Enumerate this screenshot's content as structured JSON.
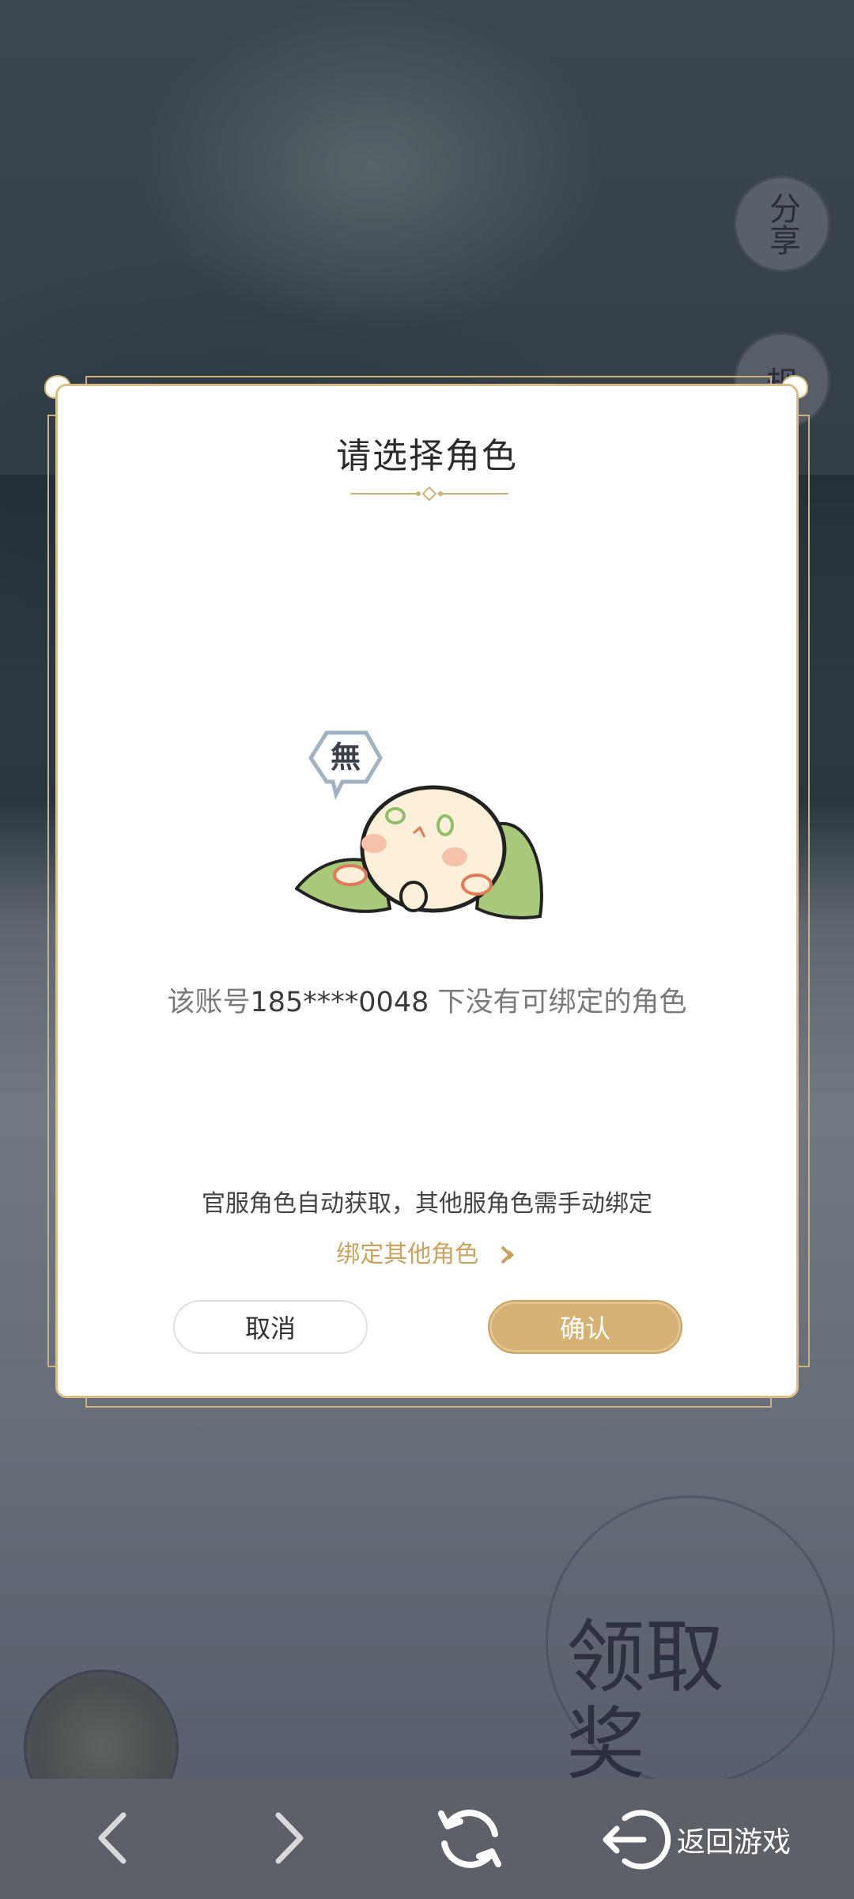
{
  "background": {
    "share_label": "分享",
    "rules_label": "规",
    "claim_label": "领取奖"
  },
  "dialog": {
    "title": "请选择角色",
    "empty_prefix": "该账号",
    "account": "185****0048",
    "empty_suffix": " 下没有可绑定的角色",
    "mascot_bubble": "無",
    "hint": "官服角色自动获取，其他服角色需手动绑定",
    "bind_other_label": "绑定其他角色",
    "cancel_label": "取消",
    "confirm_label": "确认"
  },
  "navbar": {
    "back_icon": "chevron-left-icon",
    "forward_icon": "chevron-right-icon",
    "refresh_icon": "refresh-icon",
    "return_icon": "exit-icon",
    "return_label": "返回游戏"
  },
  "colors": {
    "accent_gold": "#d6b275",
    "frame_gold": "#cdb07a",
    "navbar_bg": "#5d6068"
  }
}
